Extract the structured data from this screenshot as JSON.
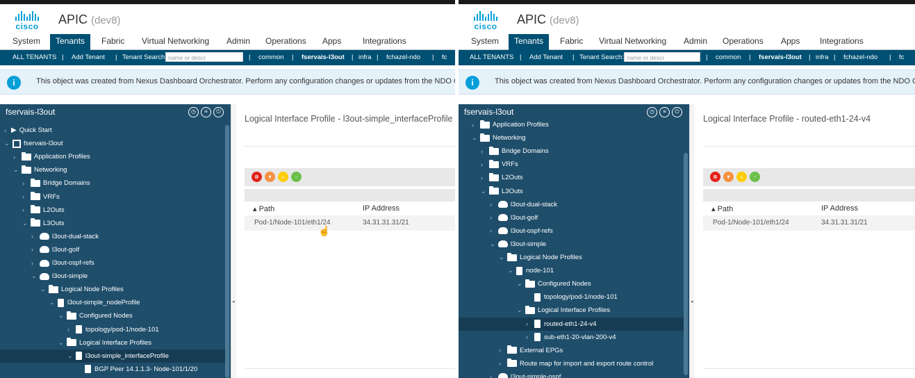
{
  "colors": {
    "accent": "#005073",
    "brand": "#049fd9",
    "tree_bg": "#1f4e6b"
  },
  "left": {
    "brand": "cisco",
    "app": "APIC",
    "env": "(dev8)",
    "tabs": [
      "System",
      "Tenants",
      "Fabric",
      "Virtual Networking",
      "Admin",
      "Operations",
      "Apps",
      "Integrations"
    ],
    "tenantbar": {
      "all": "ALL TENANTS",
      "sep1": "|",
      "add": "Add Tenant",
      "sep2": "|",
      "search_label": "Tenant Search:",
      "search_placeholder": "name or descr",
      "sep3": "|",
      "common": "common",
      "sep4": "|",
      "fservais": "fservais-l3out",
      "sep5": "|",
      "infra": "infra",
      "sep6": "|",
      "fchazel": "fchazel-ndo",
      "sep7": "|",
      "more": "fc"
    },
    "info": "This object was created from Nexus Dashboard Orchestrator. Perform any configuration changes or updates from the NDO C",
    "tree_title": "fservais-l3out",
    "tree": [
      {
        "label": "Quick Start",
        "icon": "qs"
      },
      {
        "label": "fservais-l3out",
        "icon": "tenant"
      },
      {
        "label": "Application Profiles",
        "icon": "folder"
      },
      {
        "label": "Networking",
        "icon": "folder"
      },
      {
        "label": "Bridge Domains",
        "icon": "folder"
      },
      {
        "label": "VRFs",
        "icon": "folder"
      },
      {
        "label": "L2Outs",
        "icon": "folder"
      },
      {
        "label": "L3Outs",
        "icon": "folder"
      },
      {
        "label": "l3out-dual-stack",
        "icon": "cloud"
      },
      {
        "label": "l3out-golf",
        "icon": "cloud"
      },
      {
        "label": "l3out-ospf-refs",
        "icon": "cloud"
      },
      {
        "label": "l3out-simple",
        "icon": "cloud"
      },
      {
        "label": "Logical Node Profiles",
        "icon": "folder"
      },
      {
        "label": "l3out-simple_nodeProfile",
        "icon": "doc"
      },
      {
        "label": "Configured Nodes",
        "icon": "folder"
      },
      {
        "label": "topology/pod-1/node-101",
        "icon": "doc"
      },
      {
        "label": "Logical Interface Profiles",
        "icon": "folder"
      },
      {
        "label": "l3out-simple_interfaceProfile",
        "icon": "doc"
      },
      {
        "label": "BGP Peer 14.1.1.3- Node-101/1/20",
        "icon": "doc"
      }
    ],
    "page_title": "Logical Interface Profile - l3out-simple_interfaceProfile",
    "col_path": "Path",
    "col_ip": "IP Address",
    "row_path": "Pod-1/Node-101/eth1/24",
    "row_ip": "34.31.31.31/21"
  },
  "right": {
    "brand": "cisco",
    "app": "APIC",
    "env": "(dev8)",
    "tabs": [
      "System",
      "Tenants",
      "Fabric",
      "Virtual Networking",
      "Admin",
      "Operations",
      "Apps",
      "Integrations"
    ],
    "tenantbar": {
      "all": "ALL TENANTS",
      "sep1": "|",
      "add": "Add Tenant",
      "sep2": "|",
      "search_label": "Tenant Search:",
      "search_placeholder": "name or descr",
      "sep3": "|",
      "common": "common",
      "sep4": "|",
      "fservais": "fservais-l3out",
      "sep5": "|",
      "infra": "infra",
      "sep6": "|",
      "fchazel": "fchazel-ndo",
      "sep7": "|",
      "more": "fc"
    },
    "info": "This object was created from Nexus Dashboard Orchestrator. Perform any configuration changes or updates from the NDO C",
    "tree_title": "fservais-l3out",
    "tree": [
      {
        "label": "Application Profiles",
        "icon": "folder"
      },
      {
        "label": "Networking",
        "icon": "folder"
      },
      {
        "label": "Bridge Domains",
        "icon": "folder"
      },
      {
        "label": "VRFs",
        "icon": "folder"
      },
      {
        "label": "L2Outs",
        "icon": "folder"
      },
      {
        "label": "L3Outs",
        "icon": "folder"
      },
      {
        "label": "l3out-dual-stack",
        "icon": "cloud"
      },
      {
        "label": "l3out-golf",
        "icon": "cloud"
      },
      {
        "label": "l3out-ospf-refs",
        "icon": "cloud"
      },
      {
        "label": "l3out-simple",
        "icon": "cloud"
      },
      {
        "label": "Logical Node Profiles",
        "icon": "folder"
      },
      {
        "label": "node-101",
        "icon": "doc"
      },
      {
        "label": "Configured Nodes",
        "icon": "folder"
      },
      {
        "label": "topology/pod-1/node-101",
        "icon": "doc"
      },
      {
        "label": "Logical Interface Profiles",
        "icon": "folder"
      },
      {
        "label": "routed-eth1-24-v4",
        "icon": "doc"
      },
      {
        "label": "sub-eth1-20-vlan-200-v4",
        "icon": "doc"
      },
      {
        "label": "External EPGs",
        "icon": "folder"
      },
      {
        "label": "Route map for import and export route control",
        "icon": "folder"
      },
      {
        "label": "l3out-simple-ospf",
        "icon": "cloud"
      }
    ],
    "page_title": "Logical Interface Profile - routed-eth1-24-v4",
    "col_path": "Path",
    "col_ip": "IP Address",
    "row_path": "Pod-1/Node-101/eth1/24",
    "row_ip": "34.31.31.31/21"
  }
}
